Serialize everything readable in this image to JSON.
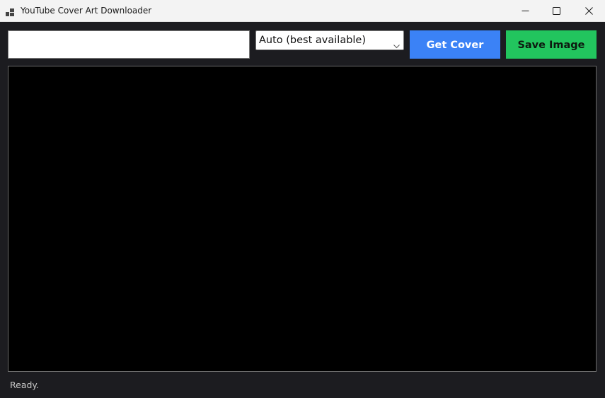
{
  "window": {
    "title": "YouTube Cover Art Downloader",
    "title_icon": "app-icon"
  },
  "caption_buttons": {
    "minimize": "minimize-icon",
    "maximize": "maximize-icon",
    "close": "close-icon"
  },
  "toolbar": {
    "url_value": "",
    "url_placeholder": "",
    "quality_selected": "Auto (best available)",
    "get_label": "Get Cover",
    "save_label": "Save Image"
  },
  "status": {
    "text": "Ready."
  },
  "colors": {
    "background": "#1c1c20",
    "get_button": "#3b82f6",
    "save_button": "#22c55e",
    "preview": "#000000"
  }
}
